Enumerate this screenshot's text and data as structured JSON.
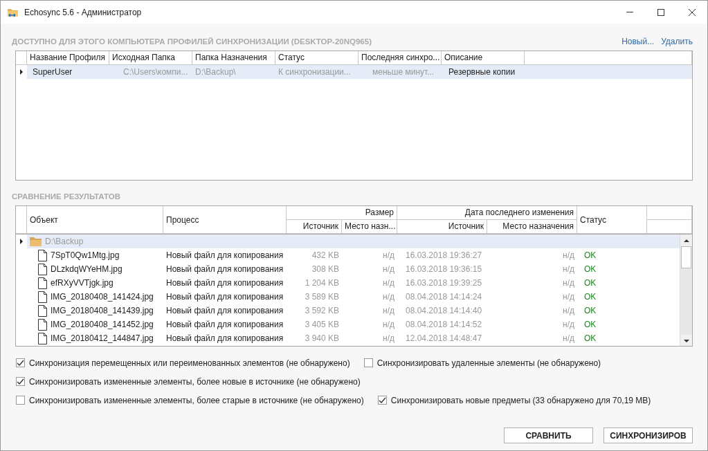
{
  "window": {
    "title": "Echosync 5.6 - Администратор"
  },
  "profiles": {
    "heading": "ДОСТУПНО ДЛЯ ЭТОГО КОМПЬЮТЕРА ПРОФИЛЕЙ СИНХРОНИЗАЦИИ (DESKTOP-20NQ965)",
    "actions": [
      "Новый...",
      "Удалить"
    ],
    "columns": [
      "Название Профиля",
      "Исходная Папка",
      "Папка Назначения",
      "Статус",
      "Последняя синхро...",
      "Описание"
    ],
    "rows": [
      {
        "selected": true,
        "cells": [
          "SuperUser",
          "C:\\Users\\компи...",
          "D:\\Backup\\",
          "К синхронизации...",
          "меньше минут...",
          "Резервные копии"
        ]
      }
    ]
  },
  "comparison": {
    "heading": "СРАВНЕНИЕ РЕЗУЛЬТАТОВ",
    "columns": {
      "object": "Объект",
      "process": "Процесс",
      "size": "Размер",
      "size_source": "Источник",
      "size_dest": "Место назн...",
      "date": "Дата последнего изменения",
      "date_source": "Источник",
      "date_dest": "Место назначения",
      "status": "Статус"
    },
    "folder": {
      "name": "D:\\Backup",
      "selected": true
    },
    "rows": [
      {
        "name": "7SpT0Qw1Mtg.jpg",
        "process": "Новый файл для копирования",
        "size_source": "432 KB",
        "size_dest": "н/д",
        "date_source": "16.03.2018 19:36:27",
        "date_dest": "н/д",
        "status": "OK"
      },
      {
        "name": "DLzkdqWYeHM.jpg",
        "process": "Новый файл для копирования",
        "size_source": "308 KB",
        "size_dest": "н/д",
        "date_source": "16.03.2018 19:36:15",
        "date_dest": "н/д",
        "status": "OK"
      },
      {
        "name": "efRXyVVTjgk.jpg",
        "process": "Новый файл для копирования",
        "size_source": "1 204 KB",
        "size_dest": "н/д",
        "date_source": "16.03.2018 19:39:25",
        "date_dest": "н/д",
        "status": "OK"
      },
      {
        "name": "IMG_20180408_141424.jpg",
        "process": "Новый файл для копирования",
        "size_source": "3 589 KB",
        "size_dest": "н/д",
        "date_source": "08.04.2018 14:14:24",
        "date_dest": "н/д",
        "status": "OK"
      },
      {
        "name": "IMG_20180408_141439.jpg",
        "process": "Новый файл для копирования",
        "size_source": "3 592 KB",
        "size_dest": "н/д",
        "date_source": "08.04.2018 14:14:40",
        "date_dest": "н/д",
        "status": "OK"
      },
      {
        "name": "IMG_20180408_141452.jpg",
        "process": "Новый файл для копирования",
        "size_source": "3 405 KB",
        "size_dest": "н/д",
        "date_source": "08.04.2018 14:14:52",
        "date_dest": "н/д",
        "status": "OK"
      },
      {
        "name": "IMG_20180412_144847.jpg",
        "process": "Новый файл для копирования",
        "size_source": "3 940 KB",
        "size_dest": "н/д",
        "date_source": "12.04.2018 14:48:47",
        "date_dest": "н/д",
        "status": "OK"
      }
    ]
  },
  "option_rows": [
    {
      "options": [
        {
          "label": "Синхронизация перемещенных или переименованных элементов (не обнаружено)",
          "checked": true
        },
        {
          "label": "Синхронизировать удаленные элементы (не обнаружено)",
          "checked": false
        }
      ]
    },
    {
      "options": [
        {
          "label": "Синхронизировать измененные элементы, более новые в источнике (не обнаружено)",
          "checked": true
        }
      ]
    },
    {
      "options": [
        {
          "label": "Синхронизировать измененные элементы, более старые в источнике (не обнаружено)",
          "checked": false
        },
        {
          "label": "Синхронизировать новые предметы (33 обнаружено для 70,19 MB)",
          "checked": true
        }
      ]
    }
  ],
  "buttons": [
    "СРАВНИТЬ",
    "СИНХРОНИЗИРОВ"
  ]
}
